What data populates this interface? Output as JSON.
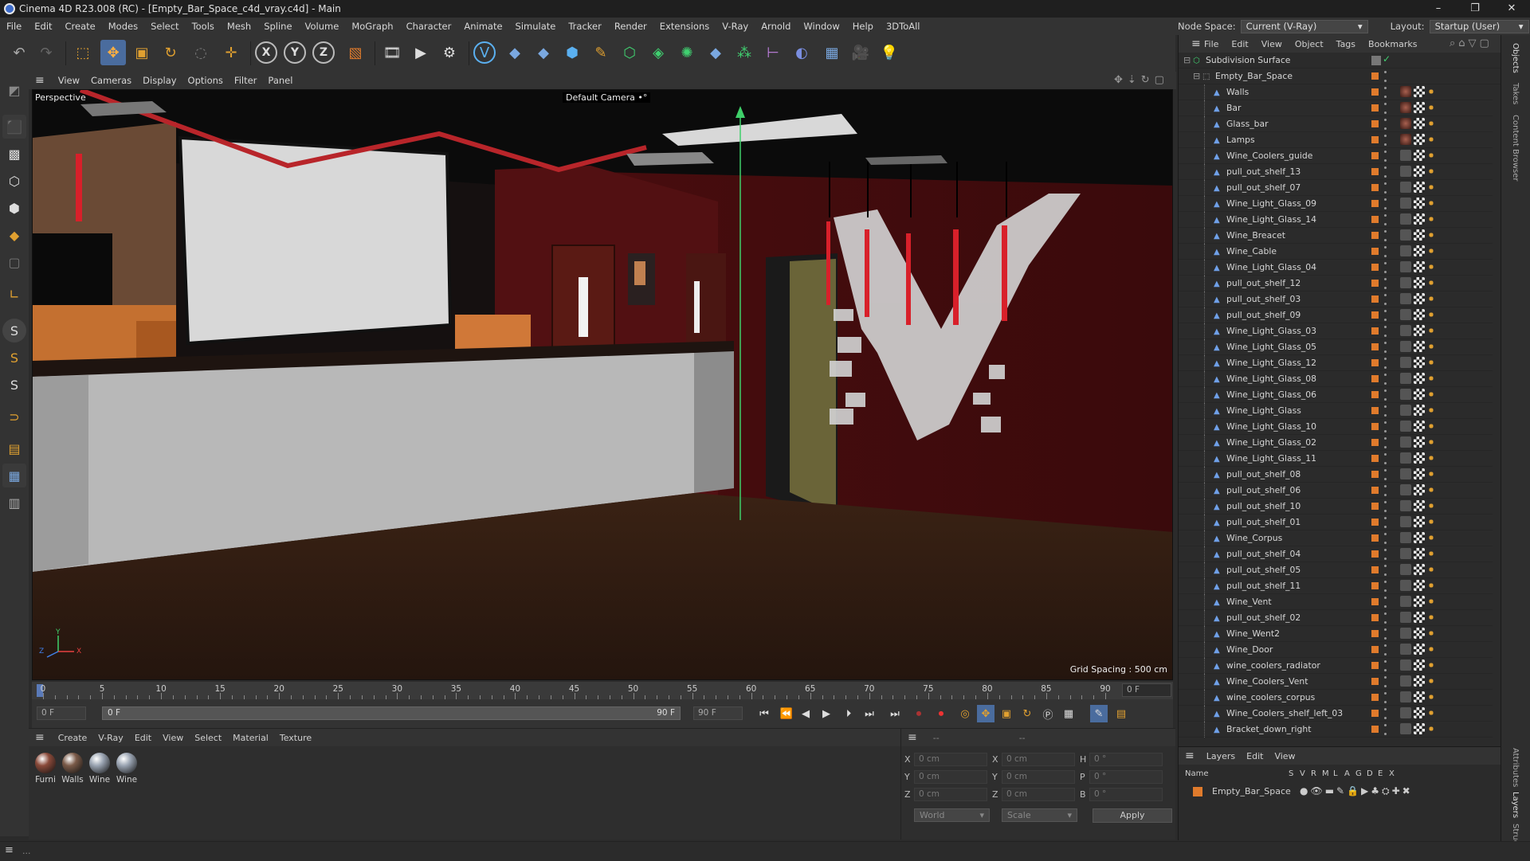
{
  "window": {
    "title": "Cinema 4D R23.008 (RC) - [Empty_Bar_Space_c4d_vray.c4d] - Main",
    "min": "–",
    "max": "❐",
    "close": "✕"
  },
  "menubar": [
    "File",
    "Edit",
    "Create",
    "Modes",
    "Select",
    "Tools",
    "Mesh",
    "Spline",
    "Volume",
    "MoGraph",
    "Character",
    "Animate",
    "Simulate",
    "Tracker",
    "Render",
    "Extensions",
    "V-Ray",
    "Arnold",
    "Window",
    "Help",
    "3DToAll"
  ],
  "nodespace": {
    "label": "Node Space:",
    "value": "Current (V-Ray)",
    "layout_label": "Layout:",
    "layout_value": "Startup (User)"
  },
  "toolbar_icons": [
    "undo-icon",
    "redo-icon",
    "select-icon",
    "move-icon",
    "scale-icon",
    "rotate-icon",
    "live-select-icon",
    "create-object-icon",
    "x-axis-icon",
    "y-axis-icon",
    "z-axis-icon",
    "coordinate-system-icon",
    "render-region-icon",
    "render-view-icon",
    "render-settings-icon",
    "vray-icon",
    "python-icon",
    "python-icon",
    "python-icon",
    "cube-icon",
    "pen-icon",
    "subdivision-icon",
    "extrude-icon",
    "cloner-icon",
    "python-icon",
    "array-icon",
    "symmetry-icon",
    "deformer-icon",
    "floor-icon",
    "camera-icon",
    "light-icon"
  ],
  "viewport": {
    "menu": [
      "View",
      "Cameras",
      "Display",
      "Options",
      "Filter",
      "Panel"
    ],
    "label": "Perspective",
    "camera": "Default Camera",
    "camera_marker": "•°",
    "grid_spacing": "Grid Spacing : 500 cm",
    "axis_y": "Y",
    "axis_z": "Z",
    "axis_x": "X"
  },
  "timeline": {
    "ticks": [
      "0",
      "5",
      "10",
      "15",
      "20",
      "25",
      "30",
      "35",
      "40",
      "45",
      "50",
      "55",
      "60",
      "65",
      "70",
      "75",
      "80",
      "85",
      "90"
    ],
    "current_frame": "0 F",
    "start": "0 F",
    "range_start": "0 F",
    "range_end": "90 F",
    "end": "90 F"
  },
  "material_manager": {
    "menu": [
      "Create",
      "V-Ray",
      "Edit",
      "View",
      "Select",
      "Material",
      "Texture"
    ],
    "materials": [
      {
        "name": "Furni",
        "color": "#8a4a3a"
      },
      {
        "name": "Walls",
        "color": "#7a5a48"
      },
      {
        "name": "Wine",
        "color": "#9aa4b2"
      },
      {
        "name": "Wine",
        "color": "#9aa4b2"
      }
    ]
  },
  "coordinates": {
    "header": "--",
    "header2": "--",
    "rows": [
      {
        "a_label": "X",
        "a_value": "0 cm",
        "b_label": "X",
        "b_value": "0 cm",
        "c_label": "H",
        "c_value": "0 °"
      },
      {
        "a_label": "Y",
        "a_value": "0 cm",
        "b_label": "Y",
        "b_value": "0 cm",
        "c_label": "P",
        "c_value": "0 °"
      },
      {
        "a_label": "Z",
        "a_value": "0 cm",
        "b_label": "Z",
        "b_value": "0 cm",
        "c_label": "B",
        "c_value": "0 °"
      }
    ],
    "world": "World",
    "scale": "Scale",
    "apply": "Apply"
  },
  "object_manager": {
    "menu": [
      "File",
      "Edit",
      "View",
      "Object",
      "Tags",
      "Bookmarks"
    ],
    "root": "Subdivision Surface",
    "group": "Empty_Bar_Space",
    "items": [
      "Walls",
      "Bar",
      "Glass_bar",
      "Lamps",
      "Wine_Coolers_guide",
      "pull_out_shelf_13",
      "pull_out_shelf_07",
      "Wine_Light_Glass_09",
      "Wine_Light_Glass_14",
      "Wine_Breacet",
      "Wine_Cable",
      "Wine_Light_Glass_04",
      "pull_out_shelf_12",
      "pull_out_shelf_03",
      "pull_out_shelf_09",
      "Wine_Light_Glass_03",
      "Wine_Light_Glass_05",
      "Wine_Light_Glass_12",
      "Wine_Light_Glass_08",
      "Wine_Light_Glass_06",
      "Wine_Light_Glass",
      "Wine_Light_Glass_10",
      "Wine_Light_Glass_02",
      "Wine_Light_Glass_11",
      "pull_out_shelf_08",
      "pull_out_shelf_06",
      "pull_out_shelf_10",
      "pull_out_shelf_01",
      "Wine_Corpus",
      "pull_out_shelf_04",
      "pull_out_shelf_05",
      "pull_out_shelf_11",
      "Wine_Vent",
      "pull_out_shelf_02",
      "Wine_Went2",
      "Wine_Door",
      "wine_coolers_radiator",
      "Wine_Coolers_Vent",
      "wine_coolers_corpus",
      "Wine_Coolers_shelf_left_03",
      "Bracket_down_right"
    ],
    "material_tag_items": [
      "Walls",
      "Bar",
      "Glass_bar",
      "Lamps"
    ]
  },
  "layers": {
    "menu": [
      "Layers",
      "Edit",
      "View"
    ],
    "columns": [
      "Name",
      "S",
      "V",
      "R",
      "M",
      "L",
      "A",
      "G",
      "D",
      "E",
      "X"
    ],
    "rows": [
      {
        "name": "Empty_Bar_Space",
        "color": "#e07b2c"
      }
    ]
  },
  "right_tabs": [
    "Objects",
    "Takes",
    "Content Browser",
    "Attributes",
    "Layers",
    "Structure"
  ],
  "colors": {
    "accent": "#e07b2c",
    "selection": "#3d6ccb",
    "green_axis": "#3fd06a"
  }
}
